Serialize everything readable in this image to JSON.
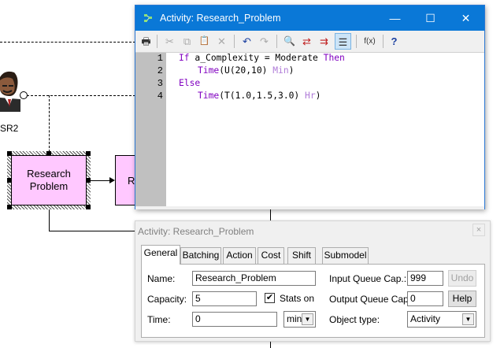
{
  "diagram": {
    "resource_label": "SR2",
    "activity_1_label": "Research Problem",
    "activity_2_label": "R"
  },
  "editor": {
    "title": "Activity: Research_Problem",
    "window_controls": {
      "minimize": "—",
      "maximize": "☐",
      "close": "✕"
    },
    "toolbar": [
      {
        "name": "print-icon",
        "glyph": "🖶"
      },
      {
        "name": "cut-icon",
        "glyph": "✂"
      },
      {
        "name": "copy-icon",
        "glyph": "⧉"
      },
      {
        "name": "paste-icon",
        "glyph": "📋"
      },
      {
        "name": "delete-icon",
        "glyph": "✕"
      },
      {
        "name": "undo-icon",
        "glyph": "↶"
      },
      {
        "name": "redo-icon",
        "glyph": "↷"
      },
      {
        "name": "find-icon",
        "glyph": "🔍"
      },
      {
        "name": "replace-icon",
        "glyph": "⇄"
      },
      {
        "name": "goto-icon",
        "glyph": "⇉"
      },
      {
        "name": "format-icon",
        "glyph": "☰"
      },
      {
        "name": "function-icon",
        "glyph": "f(x)"
      },
      {
        "name": "help-icon",
        "glyph": "?"
      }
    ],
    "line_numbers": [
      "1",
      "2",
      "3",
      "4"
    ],
    "code": {
      "line1_kw1": "If",
      "line1_mid": " a_Complexity = Moderate ",
      "line1_kw2": "Then",
      "line2_fn": "Time",
      "line2_args": "(U(20,10) ",
      "line2_unit": "Min",
      "line2_end": ")",
      "line3_kw": "Else",
      "line4_fn": "Time",
      "line4_args": "(T(1.0,1.5,3.0) ",
      "line4_unit": "Hr",
      "line4_end": ")"
    }
  },
  "properties": {
    "title": "Activity: Research_Problem",
    "close": "×",
    "tabs": [
      "General",
      "Batching",
      "Action",
      "Cost",
      "Shift",
      "Submodel"
    ],
    "active_tab": "General",
    "name_label": "Name:",
    "name_value": "Research_Problem",
    "capacity_label": "Capacity:",
    "capacity_value": "5",
    "stats_label": "Stats on",
    "stats_checked": "✔",
    "time_label": "Time:",
    "time_value": "0",
    "time_unit": "min",
    "input_queue_label": "Input Queue Cap.:",
    "input_queue_value": "999",
    "output_queue_label": "Output Queue Cap.:",
    "output_queue_value": "0",
    "object_type_label": "Object type:",
    "object_type_value": "Activity",
    "undo_label": "Undo",
    "help_label": "Help"
  }
}
